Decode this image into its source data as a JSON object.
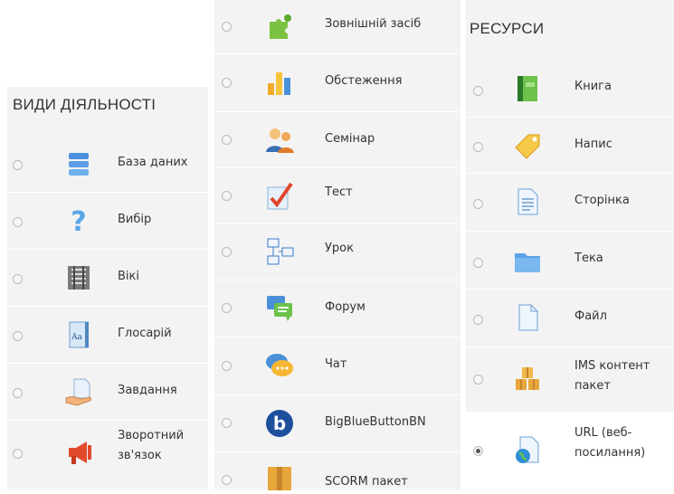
{
  "activities": {
    "heading": "ВИДИ ДІЯЛЬНОСТІ",
    "items": [
      {
        "label": "База даних",
        "icon": "database-icon"
      },
      {
        "label": "Вибір",
        "icon": "choice-question-icon"
      },
      {
        "label": "Вікі",
        "icon": "wiki-icon"
      },
      {
        "label": "Глосарій",
        "icon": "glossary-icon"
      },
      {
        "label": "Завдання",
        "icon": "assignment-icon"
      },
      {
        "label": "Зворотний зв'язок",
        "icon": "feedback-megaphone-icon"
      }
    ]
  },
  "activities_more": {
    "items": [
      {
        "label": "Зовнішній засіб",
        "icon": "external-tool-puzzle-icon"
      },
      {
        "label": "Обстеження",
        "icon": "survey-chart-icon"
      },
      {
        "label": "Семінар",
        "icon": "workshop-people-icon"
      },
      {
        "label": "Тест",
        "icon": "quiz-check-icon"
      },
      {
        "label": "Урок",
        "icon": "lesson-flow-icon"
      },
      {
        "label": "Форум",
        "icon": "forum-bubbles-icon"
      },
      {
        "label": "Чат",
        "icon": "chat-bubble-icon"
      },
      {
        "label": "BigBlueButtonBN",
        "icon": "bigbluebutton-icon"
      },
      {
        "label": "SCORM пакет",
        "icon": "scorm-package-icon"
      }
    ]
  },
  "resources": {
    "heading": "РЕСУРСИ",
    "items": [
      {
        "label": "Книга",
        "icon": "book-icon"
      },
      {
        "label": "Напис",
        "icon": "label-tag-icon"
      },
      {
        "label": "Сторінка",
        "icon": "page-icon"
      },
      {
        "label": "Тека",
        "icon": "folder-icon"
      },
      {
        "label": "Файл",
        "icon": "file-icon"
      },
      {
        "label": "IMS контент пакет",
        "icon": "ims-package-icon"
      },
      {
        "label": "URL (веб-посилання)",
        "icon": "url-globe-icon",
        "selected": true
      }
    ]
  },
  "colors": {
    "panel": "#f3f3f3",
    "selected_row": "#ffffff",
    "text": "#333333"
  }
}
